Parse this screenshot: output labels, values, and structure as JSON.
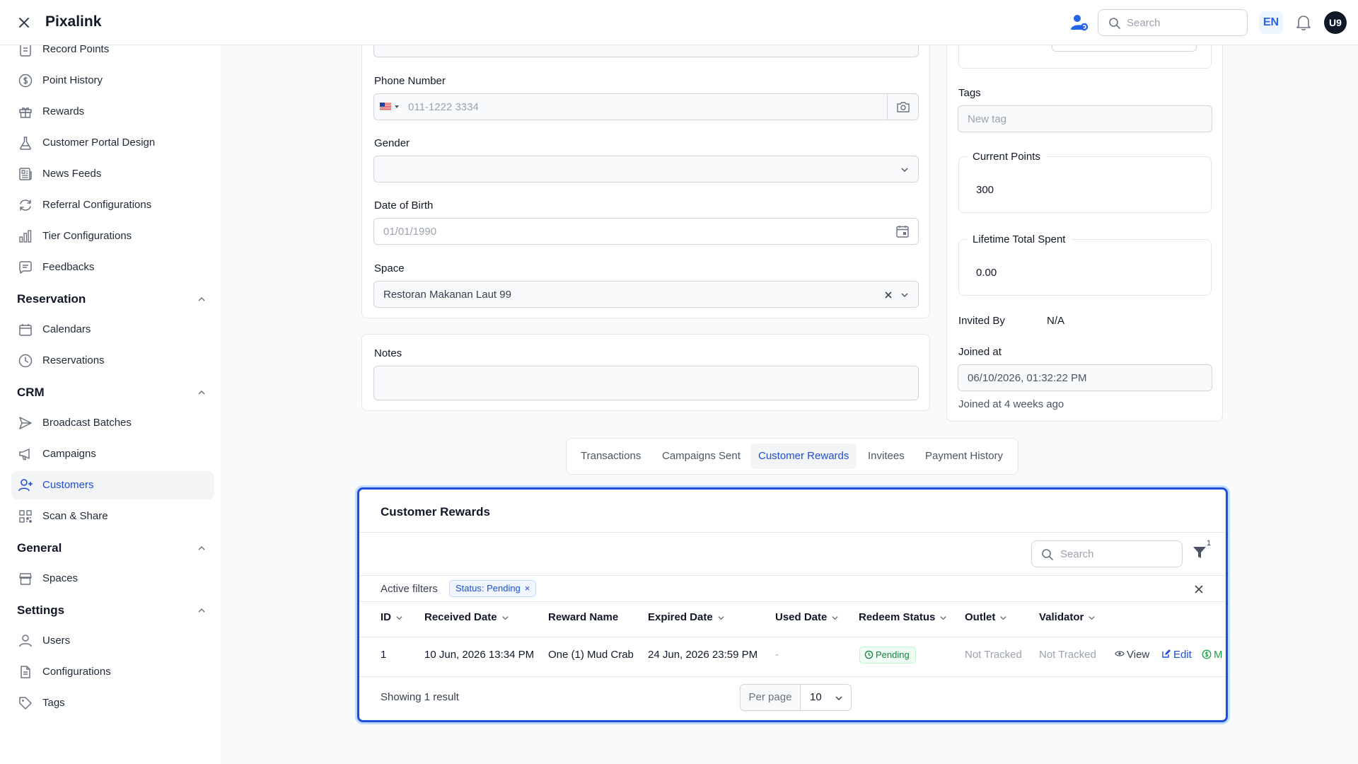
{
  "topbar": {
    "brand": "Pixalink",
    "search_placeholder": "Search",
    "lang": "EN",
    "avatar_initials": "U9"
  },
  "sidebar": {
    "items_top": [
      {
        "label": "Record Points",
        "icon": "clipboard-icon"
      },
      {
        "label": "Point History",
        "icon": "dollar-circle-icon"
      },
      {
        "label": "Rewards",
        "icon": "gift-icon"
      },
      {
        "label": "Customer Portal Design",
        "icon": "flask-icon"
      },
      {
        "label": "News Feeds",
        "icon": "newspaper-icon"
      },
      {
        "label": "Referral Configurations",
        "icon": "refresh-icon"
      },
      {
        "label": "Tier Configurations",
        "icon": "bar-chart-icon"
      },
      {
        "label": "Feedbacks",
        "icon": "message-icon"
      }
    ],
    "reservation": {
      "label": "Reservation",
      "items": [
        {
          "label": "Calendars"
        },
        {
          "label": "Reservations"
        }
      ]
    },
    "crm": {
      "label": "CRM",
      "items": [
        {
          "label": "Broadcast Batches"
        },
        {
          "label": "Campaigns"
        },
        {
          "label": "Customers"
        },
        {
          "label": "Scan & Share"
        }
      ]
    },
    "general": {
      "label": "General",
      "items": [
        {
          "label": "Spaces"
        }
      ]
    },
    "settings": {
      "label": "Settings",
      "items": [
        {
          "label": "Users"
        },
        {
          "label": "Configurations"
        },
        {
          "label": "Tags"
        }
      ]
    }
  },
  "form": {
    "phone_label": "Phone Number",
    "phone_placeholder": "011-1222 3334",
    "gender_label": "Gender",
    "gender_value": "",
    "dob_label": "Date of Birth",
    "dob_placeholder": "01/01/1990",
    "space_label": "Space",
    "space_value": "Restoran Makanan Laut 99",
    "notes_label": "Notes",
    "notes_value": ""
  },
  "side_panel": {
    "tags_label": "Tags",
    "tags_placeholder": "New tag",
    "current_points_label": "Current Points",
    "current_points_value": "300",
    "lifetime_spent_label": "Lifetime Total Spent",
    "lifetime_spent_value": "0.00",
    "invited_by_label": "Invited By",
    "invited_by_value": "N/A",
    "joined_at_label": "Joined at",
    "joined_at_value": "06/10/2026, 01:32:22 PM",
    "joined_relative": "Joined at 4 weeks ago"
  },
  "tabs": [
    "Transactions",
    "Campaigns Sent",
    "Customer Rewards",
    "Invitees",
    "Payment History"
  ],
  "active_tab": "Customer Rewards",
  "rewards": {
    "title": "Customer Rewards",
    "search_placeholder": "Search",
    "filter_count": "1",
    "active_filters_label": "Active filters",
    "filter_chip": "Status: Pending",
    "columns": [
      "ID",
      "Received Date",
      "Reward Name",
      "Expired Date",
      "Used Date",
      "Redeem Status",
      "Outlet",
      "Validator"
    ],
    "rows": [
      {
        "id": "1",
        "received": "10 Jun, 2026 13:34 PM",
        "reward": "One (1) Mud Crab",
        "expired": "24 Jun, 2026 23:59 PM",
        "used": "-",
        "status": "Pending",
        "outlet": "Not Tracked",
        "validator": "Not Tracked",
        "actions": {
          "view": "View",
          "edit": "Edit",
          "mark": "M"
        }
      }
    ],
    "showing": "Showing 1 result",
    "per_page_label": "Per page",
    "per_page_value": "10"
  },
  "colors": {
    "accent": "#1d4ed8",
    "success": "#15803d",
    "border": "#e5e7eb"
  }
}
